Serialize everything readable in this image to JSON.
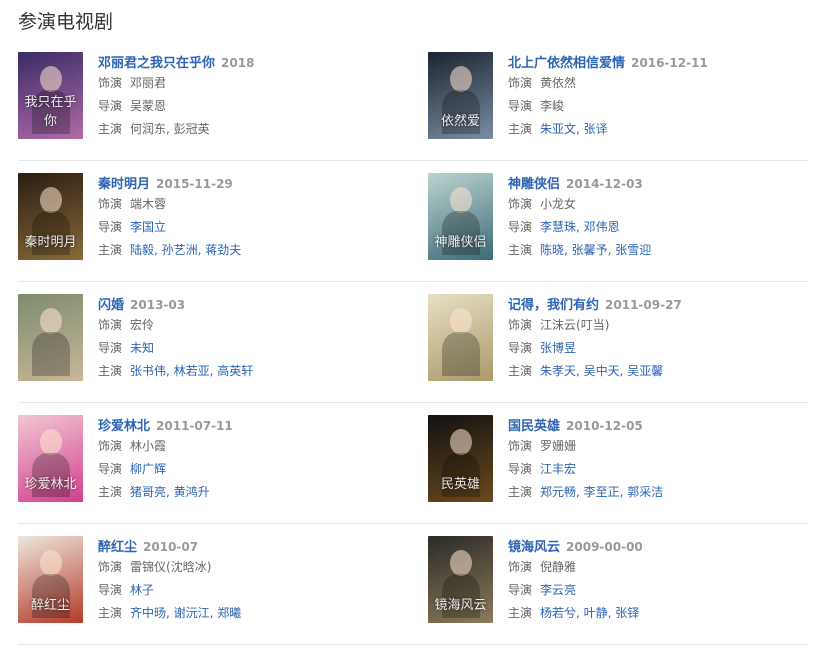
{
  "section": {
    "title": "参演电视剧"
  },
  "labels": {
    "role": "饰演",
    "director": "导演",
    "cast": "主演"
  },
  "dramas": [
    {
      "title": "邓丽君之我只在乎你",
      "date": "2018",
      "role": "邓丽君",
      "director": "吴蒙恩",
      "director_linked": false,
      "cast": "何润东, 彭冠英",
      "cast_linked": false,
      "poster_colors": [
        "#3a2b66",
        "#b06ba8"
      ],
      "poster_text": "我只在乎你"
    },
    {
      "title": "北上广依然相信爱情",
      "date": "2016-12-11",
      "role": "黄依然",
      "director": "李峻",
      "director_linked": false,
      "cast": "朱亚文, 张译",
      "cast_linked": true,
      "poster_colors": [
        "#1c2430",
        "#7a8ea3"
      ],
      "poster_text": "依然爱"
    },
    {
      "title": "秦时明月",
      "date": "2015-11-29",
      "role": "端木蓉",
      "director": "李国立",
      "director_linked": true,
      "cast": "陆毅, 孙艺洲, 蒋劲夫",
      "cast_linked": true,
      "poster_colors": [
        "#2a1d12",
        "#8a6a3a"
      ],
      "poster_text": "秦时明月"
    },
    {
      "title": "神雕侠侣",
      "date": "2014-12-03",
      "role": "小龙女",
      "director": "李慧珠, 邓伟恩",
      "director_linked": true,
      "cast": "陈晓, 张馨予, 张雪迎",
      "cast_linked": true,
      "poster_colors": [
        "#bcd3cf",
        "#3d6b78"
      ],
      "poster_text": "神雕侠侣"
    },
    {
      "title": "闪婚",
      "date": "2013-03",
      "role": "宏伶",
      "director": "未知",
      "director_linked": true,
      "cast": "张书伟, 林若亚, 高英轩",
      "cast_linked": true,
      "poster_colors": [
        "#7e8b6e",
        "#c9b79a"
      ],
      "poster_text": ""
    },
    {
      "title": "记得，我们有约",
      "date": "2011-09-27",
      "role": "江沫云(叮当)",
      "director": "张博昱",
      "director_linked": true,
      "cast": "朱孝天, 吴中天, 吴亚馨",
      "cast_linked": true,
      "poster_colors": [
        "#e8dfc4",
        "#a99a6a"
      ],
      "poster_text": ""
    },
    {
      "title": "珍爱林北",
      "date": "2011-07-11",
      "role": "林小霞",
      "director": "柳广辉",
      "director_linked": true,
      "cast": "猪哥亮, 黄鸿升",
      "cast_linked": true,
      "poster_colors": [
        "#f2c6d3",
        "#d1408c"
      ],
      "poster_text": "珍爱林北"
    },
    {
      "title": "国民英雄",
      "date": "2010-12-05",
      "role": "罗姗姗",
      "director": "江丰宏",
      "director_linked": true,
      "cast": "郑元畅, 李至正, 郭采洁",
      "cast_linked": true,
      "poster_colors": [
        "#111111",
        "#6b4a1e"
      ],
      "poster_text": "民英雄"
    },
    {
      "title": "醉红尘",
      "date": "2010-07",
      "role": "雷锦仪(沈晗冰)",
      "director": "林子",
      "director_linked": true,
      "cast": "齐中旸, 谢沅江, 郑曦",
      "cast_linked": true,
      "poster_colors": [
        "#eee6dc",
        "#b33a2a"
      ],
      "poster_text": "醉红尘"
    },
    {
      "title": "镜海风云",
      "date": "2009-00-00",
      "role": "倪静雅",
      "director": "李云亮",
      "director_linked": true,
      "cast": "杨若兮, 叶静, 张铎",
      "cast_linked": true,
      "poster_colors": [
        "#2b2a26",
        "#8c7b5c"
      ],
      "poster_text": "镜海风云"
    }
  ]
}
